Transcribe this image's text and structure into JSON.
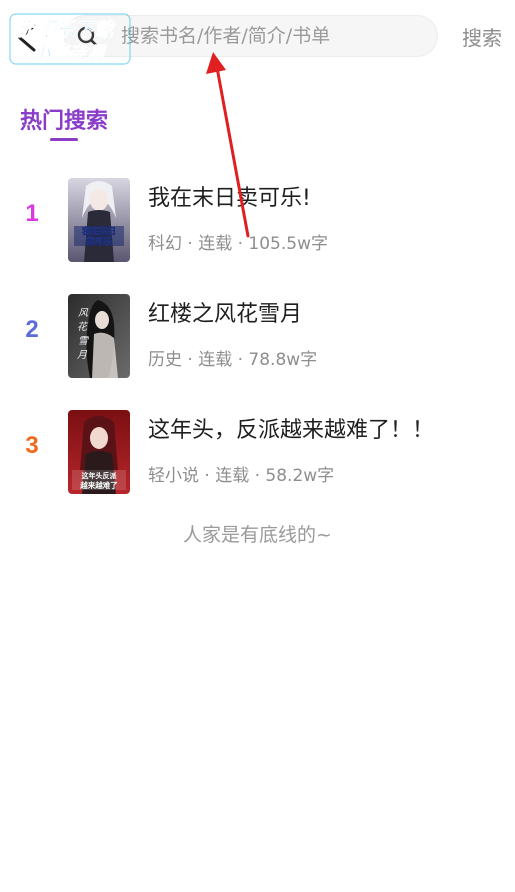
{
  "header": {
    "search_placeholder": "搜索书名/作者/简介/书单",
    "search_button": "搜索",
    "back_icon": "back-arrow-icon",
    "search_icon": "magnifier-icon"
  },
  "watermark": {
    "line1": "游吧乐下载",
    "line2": "小编亲测"
  },
  "hot_section": {
    "title": "热门搜索",
    "accent_color": "#8a3cc8",
    "items": [
      {
        "rank": "1",
        "rank_color": "#d93ae0",
        "title": "我在末日卖可乐!",
        "meta": "科幻 · 连载 · 105.5w字",
        "cover_text": "我在末日卖可乐"
      },
      {
        "rank": "2",
        "rank_color": "#5b6bd9",
        "title": "红楼之风花雪月",
        "meta": "历史 · 连载 · 78.8w字",
        "cover_text": "风花雪月"
      },
      {
        "rank": "3",
        "rank_color": "#f06a1e",
        "title": "这年头，反派越来越难了！！",
        "meta": "轻小说 · 连载 · 58.2w字",
        "cover_text": "这年头反派越来越难了"
      }
    ]
  },
  "end_note": "人家是有底线的~",
  "annotation": {
    "arrow_color": "#e02020"
  }
}
